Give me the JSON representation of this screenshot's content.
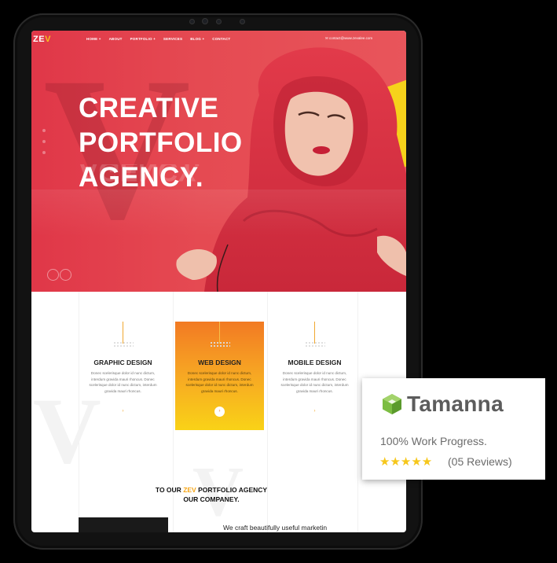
{
  "site": {
    "logo_main": "ZE",
    "logo_accent": "V",
    "nav": [
      "HOME +",
      "ABOUT",
      "PORTFOLIO +",
      "SERVICES",
      "BLOG +",
      "CONTACT"
    ],
    "email": "contact@www.zevalee.com"
  },
  "hero": {
    "headline_lines": [
      "CREATIVE",
      "PORTFOLIO",
      "AGENCY."
    ],
    "reflection": "AGENCY."
  },
  "services": [
    {
      "title": "GRAPHIC DESIGN",
      "desc": "Donec scelerisque dolor id nunc dictum, interdum gravida mauri rhoncus. Donec scelerisque dolor id nunc dictum, interdum gravida mauri rhoncus."
    },
    {
      "title": "WEB DESIGN",
      "desc": "Donec scelerisque dolor id nunc dictum, interdum gravida mauri rhoncus. Donec scelerisque dolor id nunc dictum, interdum gravida mauri rhoncus."
    },
    {
      "title": "MOBILE DESIGN",
      "desc": "Donec scelerisque dolor id nunc dictum, interdum gravida mauri rhoncus. Donec scelerisque dolor id nunc dictum, interdum gravida mauri rhoncus."
    }
  ],
  "about": {
    "prefix": "TO OUR ",
    "highlight": "ZEV",
    "suffix": " PORTFOLIO AGENCY",
    "line2": "OUR COMPANEY.",
    "craft": "We craft beautifully useful marketin"
  },
  "card": {
    "brand": "Tamanna",
    "progress": "100% Work Progress.",
    "stars": "★★★★★",
    "reviews": "(05 Reviews)"
  },
  "colors": {
    "hero": "#e03748",
    "accent_yellow": "#f6c21b",
    "service_gradient_top": "#f27a23",
    "service_gradient_bottom": "#f9d217",
    "brand_green": "#7cbd42"
  }
}
